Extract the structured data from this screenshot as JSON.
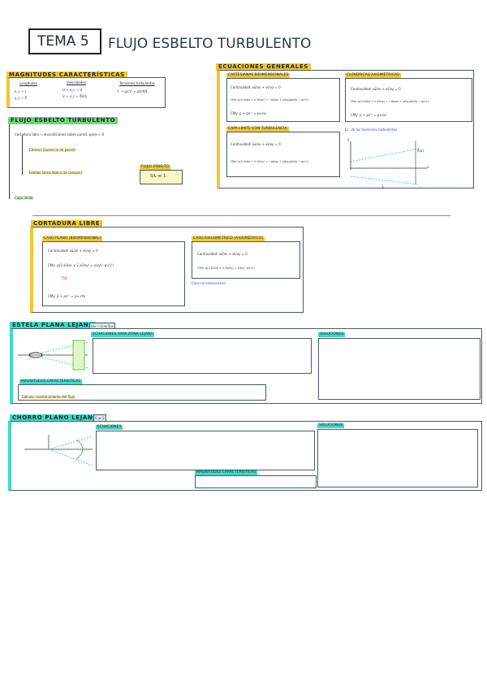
{
  "title": {
    "tema": "TEMA 5",
    "name": "FLUJO ESBELTO TURBULENTO"
  },
  "magnitudes": {
    "heading": "MAGNITUDES CARACTERÍSTICAS",
    "cols": [
      "Longitudes",
      "Velocidades",
      "Tensiones turbulentas"
    ],
    "rows": [
      "x_c ~ L",
      "y_c ~ δ",
      "U ~ u_c ~ U",
      "V ~ v_c ~ δU/L",
      "τ' ~ ρu'v' ~ ρU²δ/L"
    ]
  },
  "flujo": {
    "heading": "FLUJO ESBELTO TURBULENTO",
    "items": [
      "Cortadura libre → ∄ condiciones sobre pared, ∂p/∂x ≈ 0",
      "Chorros (ausencia de pared)",
      "Estelas (zona lejana de cuerpos)",
      "Capa límite"
    ],
    "esbelto_label": "Flujo esbelto",
    "esbelto_eq": "δ/L ≪ 1"
  },
  "generales": {
    "heading": "ECUACIONES GENERALES",
    "cart": "Cartesianas bidimensionales",
    "cil": "Cilíndricas axisimétricas",
    "cl": "Capa límite con turbulencia",
    "cont": "Continuidad: ∂ū/∂x + ∂v̄/∂y = 0",
    "cmx": "CMx: ρ(ū ∂ū/∂x + v̄ ∂ū/∂y) = −dp/dx + ∂/∂y(μ∂ū/∂y − ρu'v')",
    "cmy": "CMy: p + ρv'² = p∞(x)",
    "note": "Ec. de las tensiones turbulentas",
    "axes": [
      "x",
      "y",
      "δ(x)",
      "L"
    ]
  },
  "cortadura": {
    "heading": "CORTADURA LIBRE",
    "plano": "Caso plano (bidimensional)",
    "axi": "Caso axilsimétrico (axisimétrico)",
    "caso": "Caso no estacionario",
    "cont": "Continuidad: ∂ū/∂x + ∂v̄/∂y = 0",
    "cmx": "CMx: ρ(ū ∂ū/∂x + v̄ ∂ū/∂y) = ∂/∂y(−ρu'v')",
    "tsd": "TSD",
    "cmy": "CMy: p̄ + ρv'² = p∞ cte"
  },
  "estela": {
    "heading": "ESTELA PLANA LEJANA",
    "cond": "U∞ − ū ≪ U∞",
    "eqs": "Ecuaciones para zona lejana",
    "sol": "Soluciones",
    "magn": "Magnitudes características",
    "extra": "Cálculo: mantenimiento del flujo"
  },
  "chorro": {
    "heading": "CHORRO PLANO LEJANO",
    "cond": "ū ≫ v̄",
    "eqs": "Ecuaciones",
    "sol": "Soluciones",
    "magn": "Magnitudes características"
  }
}
